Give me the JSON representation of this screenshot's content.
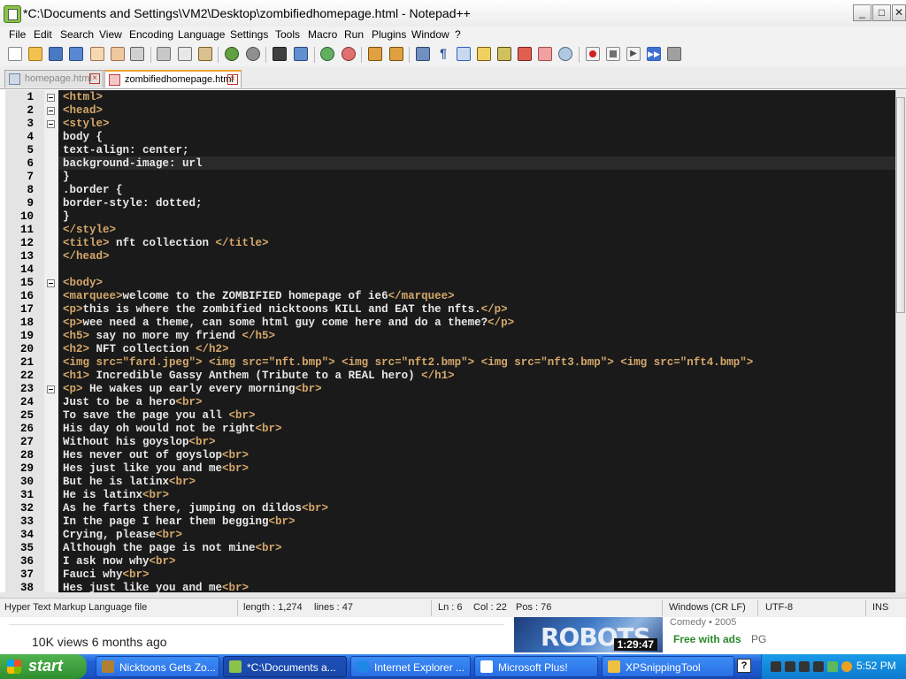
{
  "window": {
    "title": "*C:\\Documents and Settings\\VM2\\Desktop\\zombifiedhomepage.html - Notepad++",
    "minimize": "_",
    "maximize": "□",
    "close": "✕"
  },
  "menu": [
    "File",
    "Edit",
    "Search",
    "View",
    "Encoding",
    "Language",
    "Settings",
    "Tools",
    "Macro",
    "Run",
    "Plugins",
    "Window",
    "?"
  ],
  "toolbar_icons": [
    "new-file-icon",
    "open-file-icon",
    "save-icon",
    "save-all-icon",
    "close-icon",
    "close-all-icon",
    "print-icon",
    "cut-icon",
    "copy-icon",
    "paste-icon",
    "undo-icon",
    "redo-icon",
    "find-icon",
    "replace-icon",
    "zoom-in-icon",
    "zoom-out-icon",
    "sync-v-icon",
    "sync-h-icon",
    "word-wrap-icon",
    "show-all-chars-icon",
    "indent-guide-icon",
    "udl-icon",
    "doc-map-icon",
    "function-list-icon",
    "folder-workspace-icon",
    "monitor-icon",
    "record-macro-icon",
    "stop-record-icon",
    "play-macro-icon",
    "run-multiple-macro-icon",
    "save-macro-icon"
  ],
  "tabs": [
    {
      "label": "homepage.html",
      "active": false
    },
    {
      "label": "zombifiedhomepage.html",
      "active": true
    }
  ],
  "editor": {
    "lines": [
      [
        [
          "tag",
          "<html>"
        ]
      ],
      [
        [
          "tag",
          "<head>"
        ]
      ],
      [
        [
          "tag",
          "<style>"
        ]
      ],
      [
        [
          "txt",
          "body {"
        ]
      ],
      [
        [
          "txt",
          "text-align: center;"
        ]
      ],
      [
        [
          "txt",
          "background-image: url"
        ]
      ],
      [
        [
          "txt",
          "}"
        ]
      ],
      [
        [
          "txt",
          ".border {"
        ]
      ],
      [
        [
          "txt",
          "border-style: dotted;"
        ]
      ],
      [
        [
          "txt",
          "}"
        ]
      ],
      [
        [
          "tag",
          "</style>"
        ]
      ],
      [
        [
          "tag",
          "<title>"
        ],
        [
          "txt",
          " nft collection "
        ],
        [
          "tag",
          "</title>"
        ]
      ],
      [
        [
          "tag",
          "</head>"
        ]
      ],
      [],
      [
        [
          "tag",
          "<body>"
        ]
      ],
      [
        [
          "tag",
          "<marquee>"
        ],
        [
          "txt",
          "welcome to the ZOMBIFIED homepage of ie6"
        ],
        [
          "tag",
          "</marquee>"
        ]
      ],
      [
        [
          "tag",
          "<p>"
        ],
        [
          "txt",
          "this is where the zombified nicktoons KILL and EAT the nfts."
        ],
        [
          "tag",
          "</p>"
        ]
      ],
      [
        [
          "tag",
          "<p>"
        ],
        [
          "txt",
          "wee need a theme, can some html guy come here and do a theme?"
        ],
        [
          "tag",
          "</p>"
        ]
      ],
      [
        [
          "tag",
          "<h5>"
        ],
        [
          "txt",
          " say no more my friend "
        ],
        [
          "tag",
          "</h5>"
        ]
      ],
      [
        [
          "tag",
          "<h2>"
        ],
        [
          "txt",
          " NFT collection "
        ],
        [
          "tag",
          "</h2>"
        ]
      ],
      [
        [
          "tag",
          "<img src="
        ],
        [
          "str",
          "\"fard.jpeg\""
        ],
        [
          "tag",
          ">"
        ],
        [
          "txt",
          " "
        ],
        [
          "tag",
          "<img src="
        ],
        [
          "str",
          "\"nft.bmp\""
        ],
        [
          "tag",
          ">"
        ],
        [
          "txt",
          " "
        ],
        [
          "tag",
          "<img src="
        ],
        [
          "str",
          "\"nft2.bmp\""
        ],
        [
          "tag",
          ">"
        ],
        [
          "txt",
          " "
        ],
        [
          "tag",
          "<img src="
        ],
        [
          "str",
          "\"nft3.bmp\""
        ],
        [
          "tag",
          ">"
        ],
        [
          "txt",
          " "
        ],
        [
          "tag",
          "<img src="
        ],
        [
          "str",
          "\"nft4.bmp\""
        ],
        [
          "tag",
          ">"
        ]
      ],
      [
        [
          "tag",
          "<h1>"
        ],
        [
          "txt",
          " Incredible Gassy Anthem (Tribute to a REAL hero) "
        ],
        [
          "tag",
          "</h1>"
        ]
      ],
      [
        [
          "tag",
          "<p>"
        ],
        [
          "txt",
          " He wakes up early every morning"
        ],
        [
          "tag",
          "<br>"
        ]
      ],
      [
        [
          "txt",
          "Just to be a hero"
        ],
        [
          "tag",
          "<br>"
        ]
      ],
      [
        [
          "txt",
          "To save the page you all "
        ],
        [
          "tag",
          "<br>"
        ]
      ],
      [
        [
          "txt",
          "His day oh would not be right"
        ],
        [
          "tag",
          "<br>"
        ]
      ],
      [
        [
          "txt",
          "Without his goyslop"
        ],
        [
          "tag",
          "<br>"
        ]
      ],
      [
        [
          "txt",
          "Hes never out of goyslop"
        ],
        [
          "tag",
          "<br>"
        ]
      ],
      [
        [
          "txt",
          "Hes just like you and me"
        ],
        [
          "tag",
          "<br>"
        ]
      ],
      [
        [
          "txt",
          "But he is latinx"
        ],
        [
          "tag",
          "<br>"
        ]
      ],
      [
        [
          "txt",
          "He is latinx"
        ],
        [
          "tag",
          "<br>"
        ]
      ],
      [
        [
          "txt",
          "As he farts there, jumping on dildos"
        ],
        [
          "tag",
          "<br>"
        ]
      ],
      [
        [
          "txt",
          "In the page I hear them begging"
        ],
        [
          "tag",
          "<br>"
        ]
      ],
      [
        [
          "txt",
          "Crying, please"
        ],
        [
          "tag",
          "<br>"
        ]
      ],
      [
        [
          "txt",
          "Although the page is not mine"
        ],
        [
          "tag",
          "<br>"
        ]
      ],
      [
        [
          "txt",
          "I ask now why"
        ],
        [
          "tag",
          "<br>"
        ]
      ],
      [
        [
          "txt",
          "Fauci why"
        ],
        [
          "tag",
          "<br>"
        ]
      ],
      [
        [
          "txt",
          "Hes just like you and me"
        ],
        [
          "tag",
          "<br>"
        ]
      ]
    ],
    "fold_lines": [
      1,
      2,
      3,
      15,
      23
    ]
  },
  "statusbar": {
    "filetype": "Hyper Text Markup Language file",
    "length": "length : 1,274",
    "lines": "lines : 47",
    "ln": "Ln : 6",
    "col": "Col : 22",
    "pos": "Pos : 76",
    "eol": "Windows (CR LF)",
    "encoding": "UTF-8",
    "mode": "INS"
  },
  "video": {
    "views": "10K views  6 months ago",
    "thumb_title": "ROBOTS",
    "duration": "1:29:47",
    "genre": "Comedy • 2005",
    "free_label": "Free with ads",
    "rating": "PG"
  },
  "taskbar": {
    "start": "start",
    "tasks": [
      {
        "label": "Nicktoons Gets Zo...",
        "icon_color": "#b08030"
      },
      {
        "label": "*C:\\Documents a...",
        "icon_color": "#8bc34a"
      },
      {
        "label": "Internet Explorer ...",
        "icon_color": "#1e88e5"
      },
      {
        "label": "Microsoft Plus!",
        "icon_color": "#ffffff"
      },
      {
        "label": "XPSnippingTool",
        "icon_color": "#f0c040"
      }
    ],
    "clock": "5:52 PM"
  },
  "colors": {
    "editor_bg": "#1a1a1a",
    "tag": "#d4a76a",
    "text": "#e8e8e8",
    "taskbar": "#245edb"
  }
}
